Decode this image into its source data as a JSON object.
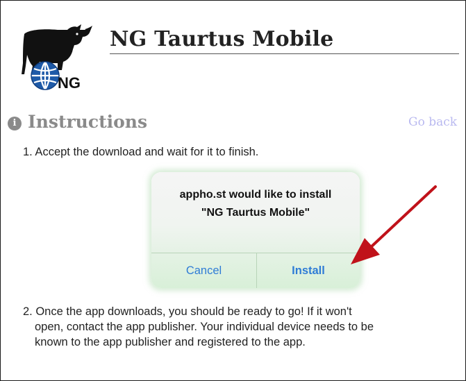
{
  "header": {
    "title": "NG Taurtus Mobile",
    "logo_text": "NG",
    "logo_icons": [
      "bull-icon",
      "globe-icon"
    ]
  },
  "instructions": {
    "heading": "Instructions",
    "info_icon": "info-icon",
    "info_symbol": "i",
    "go_back_label": "Go back",
    "step1": "1. Accept the download and wait for it to finish.",
    "step2_line1": "2. Once the app downloads, you should be ready to go! If it won't",
    "step2_line2": "open, contact the app publisher. Your individual device needs to be",
    "step2_line3": "known to the app publisher and registered to the app."
  },
  "dialog": {
    "message_line1": "appho.st would like to install",
    "message_line2": "\"NG Taurtus Mobile\"",
    "cancel_label": "Cancel",
    "install_label": "Install"
  },
  "colors": {
    "link": "#b9b9f0",
    "dialog_button": "#2f7cd6",
    "arrow": "#c0121a",
    "heading_gray": "#8a8a8a"
  },
  "annotation": {
    "arrow_icon": "red-arrow-icon"
  }
}
